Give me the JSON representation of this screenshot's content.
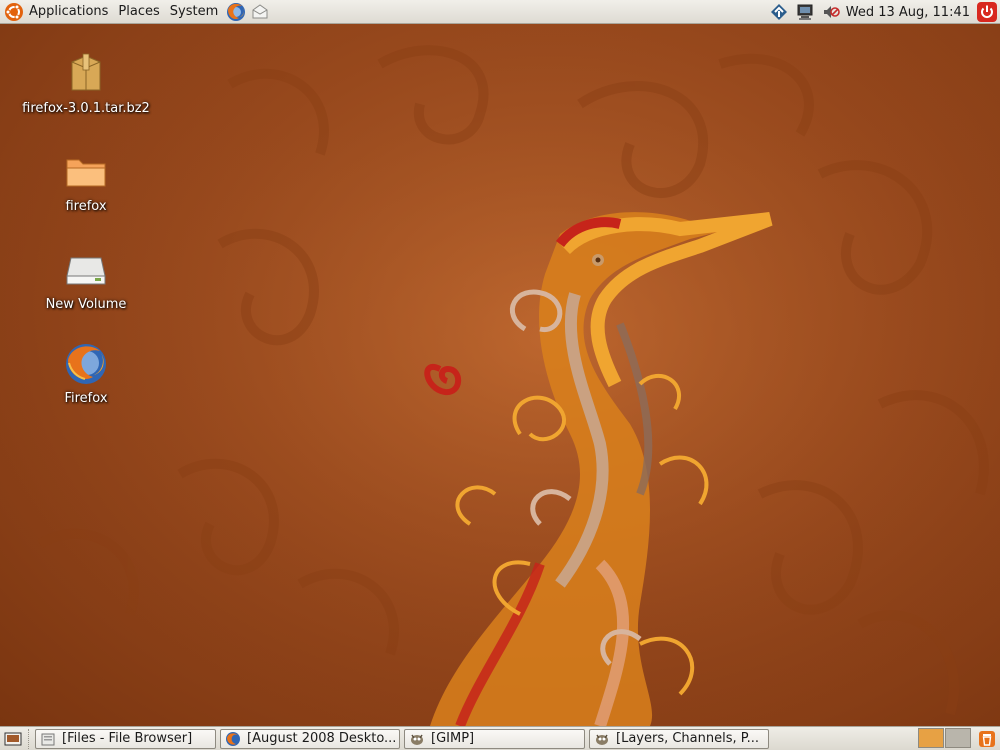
{
  "top_panel": {
    "menus": [
      {
        "label": "Applications"
      },
      {
        "label": "Places"
      },
      {
        "label": "System"
      }
    ],
    "launchers": [
      "firefox-icon",
      "mail-icon"
    ],
    "tray_icons": [
      "network-manager-icon",
      "network-monitor-icon",
      "volume-muted-icon"
    ],
    "clock": "Wed 13 Aug, 11:41",
    "shutdown_icon": "power-icon"
  },
  "desktop": {
    "icons": [
      {
        "label": "firefox-3.0.1.tar.bz2",
        "icon": "archive-icon"
      },
      {
        "label": "firefox",
        "icon": "folder-icon"
      },
      {
        "label": "New Volume",
        "icon": "drive-icon"
      },
      {
        "label": "Firefox",
        "icon": "firefox-icon"
      }
    ]
  },
  "bottom_panel": {
    "tasks": [
      {
        "label": "[Files - File Browser]",
        "icon": "file-manager-icon"
      },
      {
        "label": "[August 2008 Deskto...",
        "icon": "firefox-icon"
      },
      {
        "label": "[GIMP]",
        "icon": "gimp-icon"
      },
      {
        "label": "[Layers, Channels, P...",
        "icon": "gimp-icon"
      }
    ],
    "workspaces": [
      {
        "active": true
      },
      {
        "active": false
      }
    ],
    "trash_icon": "trash-icon"
  },
  "colors": {
    "wallpaper_base": "#9a4a1e",
    "wallpaper_accent": "#e88a1c",
    "panel": "#e6e3dc",
    "workspace_active": "#e7a144"
  }
}
